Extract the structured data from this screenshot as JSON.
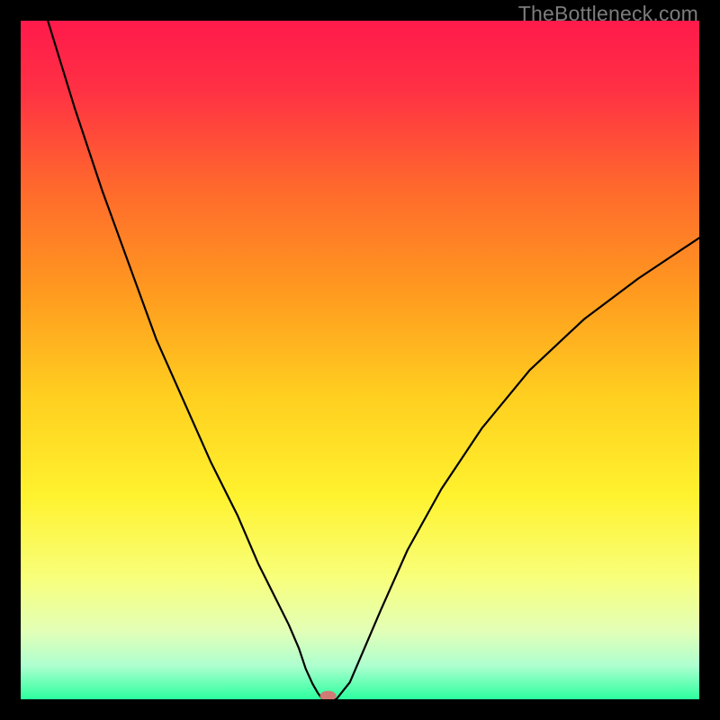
{
  "watermark": "TheBottleneck.com",
  "chart_data": {
    "type": "line",
    "title": "",
    "xlabel": "",
    "ylabel": "",
    "xlim": [
      0,
      100
    ],
    "ylim": [
      0,
      100
    ],
    "background_gradient_stops": [
      {
        "offset": 0.0,
        "color": "#ff1a4b"
      },
      {
        "offset": 0.1,
        "color": "#ff3044"
      },
      {
        "offset": 0.25,
        "color": "#ff6a2c"
      },
      {
        "offset": 0.4,
        "color": "#ff9a1f"
      },
      {
        "offset": 0.55,
        "color": "#ffce1f"
      },
      {
        "offset": 0.7,
        "color": "#fff22e"
      },
      {
        "offset": 0.82,
        "color": "#f8ff7a"
      },
      {
        "offset": 0.9,
        "color": "#e2ffb7"
      },
      {
        "offset": 0.95,
        "color": "#aeffcf"
      },
      {
        "offset": 1.0,
        "color": "#2bff9e"
      }
    ],
    "series": [
      {
        "name": "bottleneck-curve",
        "stroke": "#000000",
        "stroke_width": 2.2,
        "x": [
          4.0,
          8.0,
          12.0,
          16.0,
          20.0,
          24.0,
          28.0,
          32.0,
          35.0,
          37.5,
          39.5,
          41.0,
          42.0,
          43.0,
          43.8,
          44.5,
          46.5,
          48.5,
          50.0,
          53.0,
          57.0,
          62.0,
          68.0,
          75.0,
          83.0,
          91.0,
          100.0
        ],
        "y": [
          100.0,
          87.0,
          75.0,
          64.0,
          53.0,
          44.0,
          35.0,
          27.0,
          20.0,
          15.0,
          11.0,
          7.5,
          4.5,
          2.3,
          0.9,
          0.0,
          0.0,
          2.5,
          6.0,
          13.0,
          22.0,
          31.0,
          40.0,
          48.5,
          56.0,
          62.0,
          68.0
        ]
      }
    ],
    "marker": {
      "name": "optimal-point",
      "x": 45.3,
      "y": 0.5,
      "rx": 1.2,
      "ry": 0.75,
      "fill": "#cf7a74"
    }
  }
}
